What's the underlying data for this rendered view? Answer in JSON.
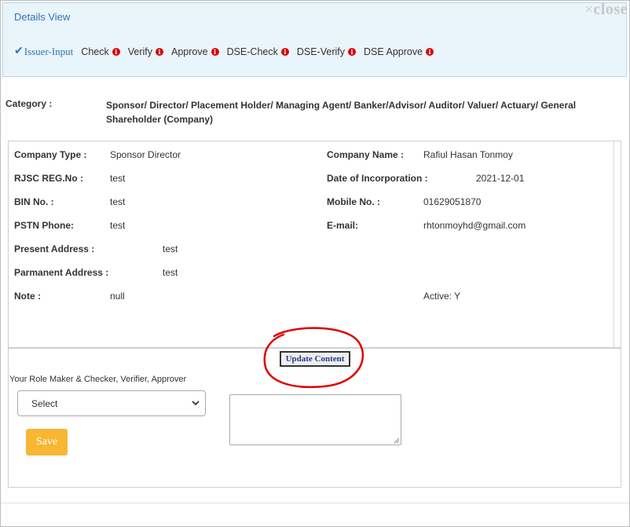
{
  "header": {
    "title": "Details View",
    "close_symbol": "×",
    "close_label": "close"
  },
  "steps": [
    {
      "label": "Issuer-Input",
      "status": "done",
      "icon": "check-icon"
    },
    {
      "label": "Check",
      "status": "pending",
      "icon": "info-icon"
    },
    {
      "label": "Verify",
      "status": "pending",
      "icon": "info-icon"
    },
    {
      "label": "Approve",
      "status": "pending",
      "icon": "info-icon"
    },
    {
      "label": "DSE-Check",
      "status": "pending",
      "icon": "info-icon"
    },
    {
      "label": "DSE-Verify",
      "status": "pending",
      "icon": "info-icon"
    },
    {
      "label": "DSE Approve",
      "status": "pending",
      "icon": "info-icon"
    }
  ],
  "info_icon_glyph": "i",
  "check_glyph": "✔",
  "category": {
    "label": "Category :",
    "value": "Sponsor/ Director/ Placement Holder/ Managing Agent/ Banker/Advisor/ Auditor/ Valuer/ Actuary/ General Shareholder (Company)"
  },
  "details": {
    "company_type": {
      "label": "Company Type :",
      "value": "Sponsor Director"
    },
    "company_name": {
      "label": "Company Name :",
      "value": "Rafiul Hasan Tonmoy"
    },
    "rjsc": {
      "label": "RJSC REG.No :",
      "value": "test"
    },
    "incorporation": {
      "label": "Date of Incorporation :",
      "value": "2021-12-01"
    },
    "bin": {
      "label": "BIN No. :",
      "value": "test"
    },
    "mobile": {
      "label": "Mobile No. :",
      "value": "01629051870"
    },
    "pstn": {
      "label": "PSTN Phone:",
      "value": "test"
    },
    "email": {
      "label": "E-mail:",
      "value": "rhtonmoyhd@gmail.com"
    },
    "present_address": {
      "label": "Present Address :",
      "value": "test"
    },
    "permanent_address": {
      "label": "Parmanent Address :",
      "value": "test"
    },
    "note": {
      "label": "Note :",
      "value": "null"
    },
    "active": "Active: Y"
  },
  "actions": {
    "update_label": "Update Content",
    "role_text": "Your Role Maker & Checker, Verifier, Approver",
    "select_value": "Select",
    "save_label": "Save",
    "remarks_value": ""
  },
  "colors": {
    "accent": "#2c75b3",
    "info_red": "#d90000",
    "save": "#f7b733",
    "annotation_circle": "#e00000"
  }
}
